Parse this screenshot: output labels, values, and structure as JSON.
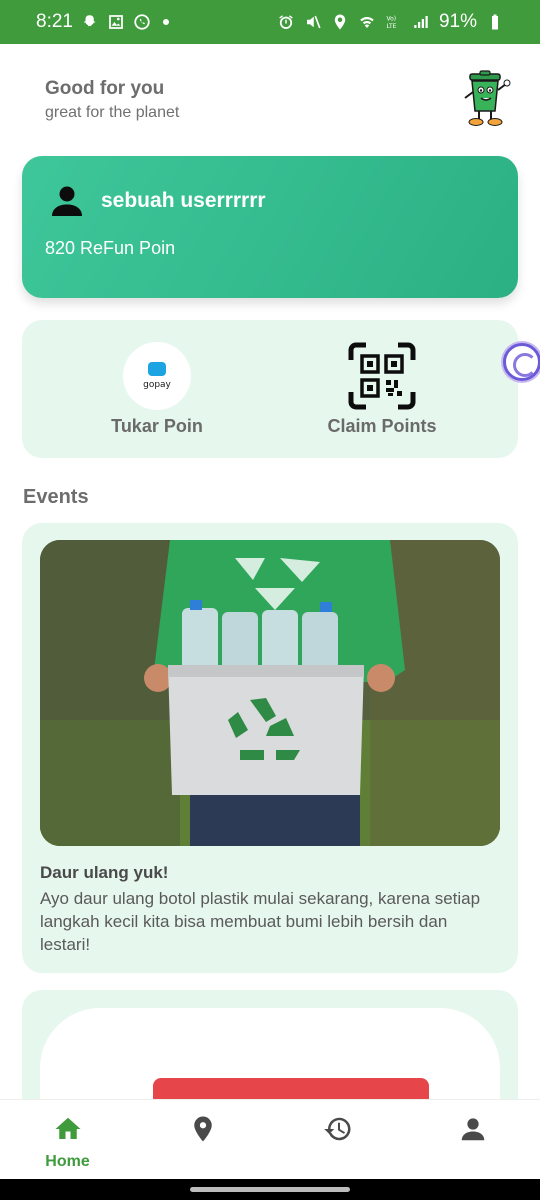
{
  "status_bar": {
    "time": "8:21",
    "battery": "91%",
    "left_icons": [
      "snapchat-icon",
      "gallery-icon",
      "whatsapp-icon",
      "dot-icon"
    ],
    "right_icons": [
      "alarm-icon",
      "mute-icon",
      "location-icon",
      "wifi-icon",
      "volte-icon",
      "signal-icon",
      "battery-icon"
    ]
  },
  "header": {
    "title": "Good for you",
    "subtitle": "great for the planet"
  },
  "user_card": {
    "username": "sebuah userrrrrr",
    "points": "820 ReFun Poin"
  },
  "actions": {
    "tukar": {
      "label": "Tukar Poin",
      "logo_text": "gopay"
    },
    "claim": {
      "label": "Claim Points"
    }
  },
  "events": {
    "title": "Events",
    "items": [
      {
        "title": "Daur ulang yuk!",
        "description": "Ayo daur ulang botol plastik mulai sekarang, karena setiap langkah kecil kita bisa membuat bumi lebih bersih dan lestari!"
      }
    ]
  },
  "bottom_nav": {
    "items": [
      {
        "label": "Home",
        "icon": "home-icon",
        "active": true
      },
      {
        "label": "",
        "icon": "location-pin-icon",
        "active": false
      },
      {
        "label": "",
        "icon": "history-icon",
        "active": false
      },
      {
        "label": "",
        "icon": "profile-icon",
        "active": false
      }
    ]
  },
  "colors": {
    "primary": "#3f9b3c",
    "card_gradient_start": "#3ec79a",
    "card_gradient_end": "#2bb083",
    "card_bg": "#e6f7ee"
  }
}
